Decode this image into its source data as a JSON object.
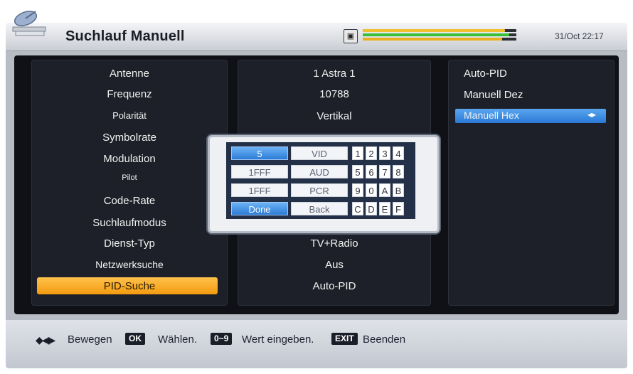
{
  "header": {
    "title": "Suchlauf Manuell",
    "signal_icon": "signal-icon",
    "datetime": "31/Oct 22:17"
  },
  "menu": {
    "items": [
      {
        "label": "Antenne",
        "value": "1 Astra 1"
      },
      {
        "label": "Frequenz",
        "value": "10788"
      },
      {
        "label": "Polarität",
        "value": "Vertikal"
      },
      {
        "label": "Symbolrate",
        "value": ""
      },
      {
        "label": "Modulation",
        "value": ""
      },
      {
        "label": "Pilot",
        "value": ""
      },
      {
        "label": "Code-Rate",
        "value": ""
      },
      {
        "label": "Suchlaufmodus",
        "value": ""
      },
      {
        "label": "Dienst-Typ",
        "value": "TV+Radio"
      },
      {
        "label": "Netzwerksuche",
        "value": "Aus"
      },
      {
        "label": "PID-Suche",
        "value": "Auto-PID",
        "selected": true
      }
    ]
  },
  "options": {
    "items": [
      {
        "label": "Auto-PID"
      },
      {
        "label": "Manuell Dez"
      },
      {
        "label": "Manuell Hex",
        "selected": true,
        "icon": "left-right-arrows-icon"
      }
    ]
  },
  "keypad": {
    "fields": [
      {
        "value": "5",
        "label": "VID",
        "active": true
      },
      {
        "value": "1FFF",
        "label": "AUD"
      },
      {
        "value": "1FFF",
        "label": "PCR"
      },
      {
        "value": "Done",
        "label": "Back",
        "active": true
      }
    ],
    "keys": [
      [
        "1",
        "2",
        "3",
        "4"
      ],
      [
        "5",
        "6",
        "7",
        "8"
      ],
      [
        "9",
        "0",
        "A",
        "B"
      ],
      [
        "C",
        "D",
        "E",
        "F"
      ]
    ]
  },
  "footer": {
    "move_label": "Bewegen",
    "ok_key": "OK",
    "ok_label": "Wählen.",
    "num_key": "0~9",
    "num_label": "Wert eingeben.",
    "exit_key": "EXIT",
    "exit_label": "Beenden"
  },
  "colors": {
    "highlight_orange": "#f39a10",
    "highlight_blue": "#2a79d6",
    "panel_dark": "#1d2028"
  }
}
